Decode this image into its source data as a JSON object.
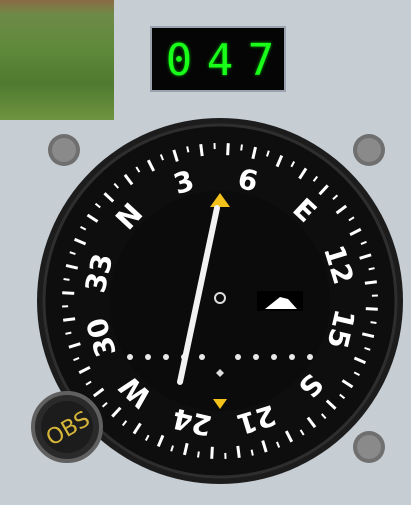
{
  "readout": {
    "digits": [
      "0",
      "4",
      "7"
    ]
  },
  "instrument": {
    "selected_course": 47,
    "cardinals": {
      "N": "N",
      "E": "E",
      "S": "S",
      "W": "W"
    },
    "numbers": [
      "3",
      "6",
      "12",
      "15",
      "21",
      "24",
      "30",
      "33"
    ],
    "obs_knob_label": "OBS",
    "colors": {
      "readout_text": "#19ff19",
      "needle": "#ffffff",
      "index": "#f2c21a",
      "knob_text": "#d6b63a"
    }
  },
  "icons": [
    "field-camera-thumbnail",
    "screw-icon",
    "to-from-flag-icon",
    "course-index-icon",
    "obs-knob"
  ]
}
